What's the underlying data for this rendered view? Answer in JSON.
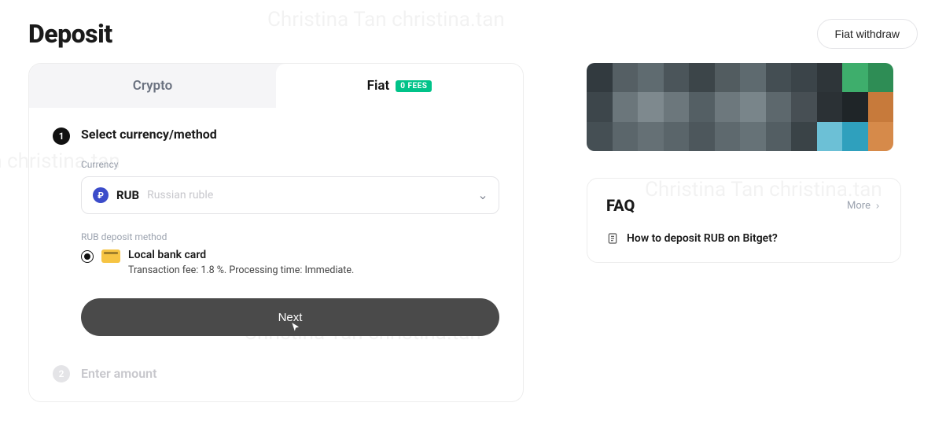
{
  "header": {
    "title": "Deposit",
    "fiat_withdraw": "Fiat withdraw"
  },
  "tabs": {
    "crypto": "Crypto",
    "fiat": "Fiat",
    "fiat_badge": "0 FEES"
  },
  "step1": {
    "num": "1",
    "title": "Select currency/method",
    "currency_label": "Currency",
    "currency_code": "RUB",
    "currency_name": "Russian ruble",
    "method_label": "RUB deposit method",
    "method_name": "Local bank card",
    "method_sub": "Transaction fee: 1.8 %. Processing time: Immediate.",
    "next": "Next"
  },
  "step2": {
    "num": "2",
    "title": "Enter amount"
  },
  "faq": {
    "title": "FAQ",
    "more": "More",
    "items": [
      "How to deposit RUB on Bitget?"
    ]
  },
  "icons": {
    "coin_letter": "₽"
  }
}
